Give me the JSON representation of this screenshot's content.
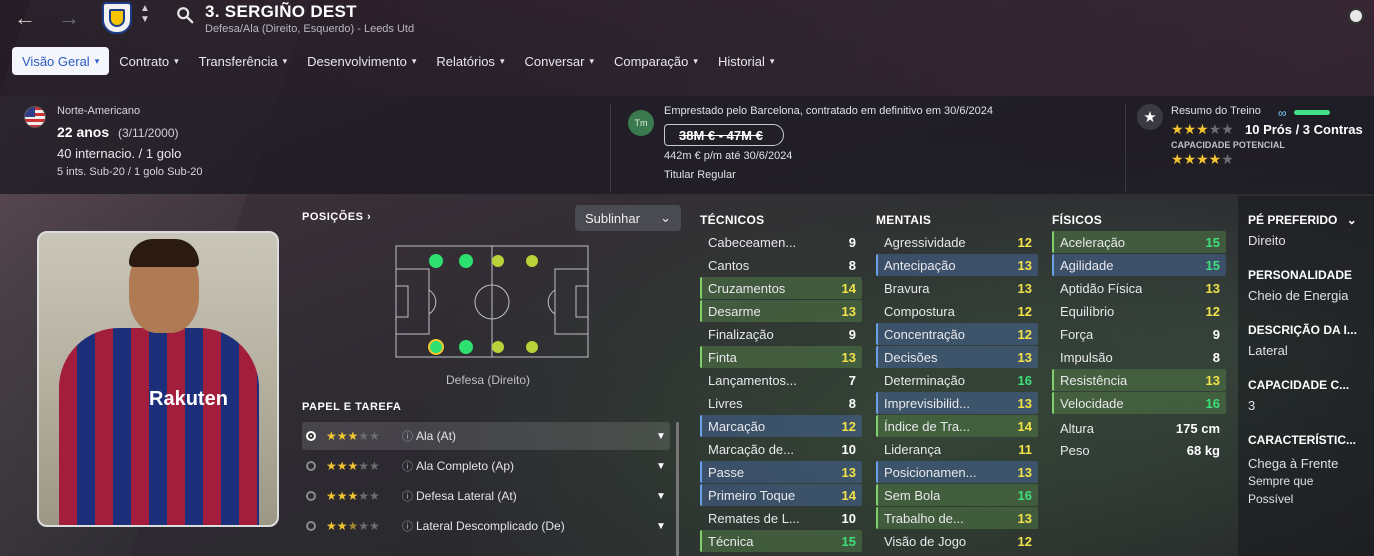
{
  "header": {
    "back_icon": "←",
    "forward_icon": "→",
    "player_title": "3. SERGIÑO DEST",
    "player_subtitle": "Defesa/Ala (Direito, Esquerdo) - Leeds Utd"
  },
  "tabs": [
    {
      "label": "Visão Geral",
      "active": true
    },
    {
      "label": "Contrato"
    },
    {
      "label": "Transferência"
    },
    {
      "label": "Desenvolvimento"
    },
    {
      "label": "Relatórios"
    },
    {
      "label": "Conversar"
    },
    {
      "label": "Comparação"
    },
    {
      "label": "Historial"
    }
  ],
  "profile": {
    "nationality": "Norte-Americano",
    "age": "22 anos",
    "dob": "(3/11/2000)",
    "caps": "40 internacio. / 1 golo",
    "youth_caps": "5 ints. Sub-20 / 1 golo Sub-20"
  },
  "contract": {
    "agent_badge": "Tm",
    "loan_text": "Emprestado pelo Barcelona, contratado em definitivo em 30/6/2024",
    "value": "38M € - 47M €",
    "wage": "442m € p/m até 30/6/2024",
    "status": "Titular Regular"
  },
  "training": {
    "label": "Resumo do Treino",
    "progress": 1.0,
    "current_stars": 3,
    "pros_cons": "10 Prós / 3 Contras",
    "potential_label": "CAPACIDADE POTENCIAL",
    "potential_stars": 4
  },
  "positions": {
    "label": "POSIÇÕES",
    "dropdown": "Sublinhar",
    "position_caption": "Defesa (Direito)"
  },
  "roles": {
    "label": "PAPEL E TAREFA",
    "items": [
      {
        "name": "Ala (At)",
        "stars": 3,
        "selected": true
      },
      {
        "name": "Ala Completo (Ap)",
        "stars": 3
      },
      {
        "name": "Defesa Lateral (At)",
        "stars": 3
      },
      {
        "name": "Lateral Descomplicado (De)",
        "stars": 2.5
      }
    ]
  },
  "technical": {
    "label": "TÉCNICOS",
    "rows": [
      {
        "name": "Cabeceamen...",
        "value": "9",
        "hl": ""
      },
      {
        "name": "Cantos",
        "value": "8",
        "hl": ""
      },
      {
        "name": "Cruzamentos",
        "value": "14",
        "hl": "green"
      },
      {
        "name": "Desarme",
        "value": "13",
        "hl": "green"
      },
      {
        "name": "Finalização",
        "value": "9",
        "hl": ""
      },
      {
        "name": "Finta",
        "value": "13",
        "hl": "green"
      },
      {
        "name": "Lançamentos...",
        "value": "7",
        "hl": ""
      },
      {
        "name": "Livres",
        "value": "8",
        "hl": ""
      },
      {
        "name": "Marcação",
        "value": "12",
        "hl": "blue"
      },
      {
        "name": "Marcação de...",
        "value": "10",
        "hl": ""
      },
      {
        "name": "Passe",
        "value": "13",
        "hl": "blue"
      },
      {
        "name": "Primeiro Toque",
        "value": "14",
        "hl": "blue"
      },
      {
        "name": "Remates de L...",
        "value": "10",
        "hl": ""
      },
      {
        "name": "Técnica",
        "value": "15",
        "hl": "green"
      }
    ]
  },
  "mental": {
    "label": "MENTAIS",
    "rows": [
      {
        "name": "Agressividade",
        "value": "12",
        "hl": ""
      },
      {
        "name": "Antecipação",
        "value": "13",
        "hl": "blue"
      },
      {
        "name": "Bravura",
        "value": "13",
        "hl": ""
      },
      {
        "name": "Compostura",
        "value": "12",
        "hl": ""
      },
      {
        "name": "Concentração",
        "value": "12",
        "hl": "blue"
      },
      {
        "name": "Decisões",
        "value": "13",
        "hl": "blue"
      },
      {
        "name": "Determinação",
        "value": "16",
        "hl": ""
      },
      {
        "name": "Imprevisibilid...",
        "value": "13",
        "hl": "blue"
      },
      {
        "name": "Índice de Tra...",
        "value": "14",
        "hl": "green"
      },
      {
        "name": "Liderança",
        "value": "11",
        "hl": ""
      },
      {
        "name": "Posicionamen...",
        "value": "13",
        "hl": "blue"
      },
      {
        "name": "Sem Bola",
        "value": "16",
        "hl": "green"
      },
      {
        "name": "Trabalho de...",
        "value": "13",
        "hl": "green"
      },
      {
        "name": "Visão de Jogo",
        "value": "12",
        "hl": ""
      }
    ]
  },
  "physical": {
    "label": "FÍSICOS",
    "rows": [
      {
        "name": "Aceleração",
        "value": "15",
        "hl": "green"
      },
      {
        "name": "Agilidade",
        "value": "15",
        "hl": "blue"
      },
      {
        "name": "Aptidão Física",
        "value": "13",
        "hl": ""
      },
      {
        "name": "Equilíbrio",
        "value": "12",
        "hl": ""
      },
      {
        "name": "Força",
        "value": "9",
        "hl": ""
      },
      {
        "name": "Impulsão",
        "value": "8",
        "hl": ""
      },
      {
        "name": "Resistência",
        "value": "13",
        "hl": "green"
      },
      {
        "name": "Velocidade",
        "value": "16",
        "hl": "green"
      }
    ],
    "height_label": "Altura",
    "height": "175 cm",
    "weight_label": "Peso",
    "weight": "68 kg"
  },
  "side": {
    "foot_label": "PÉ PREFERIDO",
    "foot": "Direito",
    "personality_label": "PERSONALIDADE",
    "personality": "Cheio de Energia",
    "media_label": "DESCRIÇÃO DA I...",
    "media": "Lateral",
    "ability_label": "CAPACIDADE C...",
    "ability": "3",
    "traits_label": "CARACTERÍSTIC...",
    "traits": [
      "Chega à Frente",
      "Sempre que",
      "Possível"
    ]
  },
  "colors": {
    "accent_blue": "#2b5bc4",
    "star": "#f2c531",
    "attr_green": "#3ee07a",
    "attr_yellow": "#f1e24a"
  }
}
